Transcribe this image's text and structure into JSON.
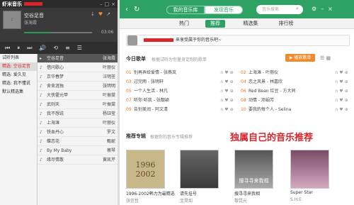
{
  "app": {
    "title": "虾米音乐"
  },
  "now_playing": {
    "song": "空谷足音",
    "artist": "张海霞",
    "time": "03:06",
    "progress": 0.4
  },
  "playlists": [
    {
      "label": "试听列表"
    },
    {
      "label": "精选: 空谷足音"
    },
    {
      "label": "精选: 爱久见"
    },
    {
      "label": "精选: 我不懂说"
    },
    {
      "label": "默认精选集"
    }
  ],
  "tracks": [
    {
      "num": "",
      "title": "空谷足音",
      "artist": "张海霞"
    },
    {
      "num": "",
      "title": "借问歌心",
      "artist": "叶丽仪"
    },
    {
      "num": "",
      "title": "京华春梦",
      "artist": "汪明荃"
    },
    {
      "num": "",
      "title": "舍舍涯独",
      "artist": "张明明"
    },
    {
      "num": "",
      "title": "大侠霍元甲",
      "artist": "叶振棠"
    },
    {
      "num": "",
      "title": "武则天",
      "artist": "叶振棠"
    },
    {
      "num": "",
      "title": "我不想说",
      "artist": "杨钰莹"
    },
    {
      "num": "",
      "title": "上海滩",
      "artist": "叶丽仪"
    },
    {
      "num": "",
      "title": "铁血丹心",
      "artist": "罗文"
    },
    {
      "num": "",
      "title": "蝶恋花",
      "artist": "甄妮"
    },
    {
      "num": "",
      "title": "By My Baby",
      "artist": "蔡琴"
    },
    {
      "num": "",
      "title": "缘尽情散",
      "artist": "黄凯芹"
    }
  ],
  "store": {
    "tabs": [
      "我的音乐库",
      "发现音乐"
    ],
    "search_placeholder": "音乐搜索",
    "subnav": [
      "热门",
      "推荐",
      "精选集",
      "排行榜"
    ],
    "greeting": "来享受属于你的音乐吧~",
    "daily_title": "今日歌单",
    "daily_sub": "根据试听为你量身定制的歌单",
    "add_button": "▶ 播放歌单",
    "daily_left": [
      {
        "n": "01",
        "t": "别再弄给爱情 - 张燕岚"
      },
      {
        "n": "03",
        "t": "过完雨 - 张明轩"
      },
      {
        "n": "05",
        "t": "一个人生活 - 林凡"
      },
      {
        "n": "07",
        "t": "听你·听我 - 张靓颖"
      },
      {
        "n": "09",
        "t": "告别美润 - 阿文清"
      }
    ],
    "daily_right": [
      {
        "n": "02",
        "t": "上海滩 - 叶丽仪"
      },
      {
        "n": "04",
        "t": "恋之风景 - 林嘉欣"
      },
      {
        "n": "06",
        "t": "Red Bean 红豆 - 方大同"
      },
      {
        "n": "08",
        "t": "动情 - 邓娟芳"
      },
      {
        "n": "10",
        "t": "要我的每个人 - Selina"
      }
    ],
    "rec_title": "推荐专辑",
    "rec_sub": "根据你的音乐专辑推荐",
    "slogan": "独属自己的音乐推荐",
    "albums": [
      {
        "title": "1996-2002韩力为最精选",
        "artist": "张信哲",
        "cover": "1996\n2002"
      },
      {
        "title": "请先挂号",
        "artist": "宝晃如",
        "cover": ""
      },
      {
        "title": "搜寻寻来我相",
        "artist": "黎昆元",
        "cover": "搜寻寻来我相"
      },
      {
        "title": "Super Star",
        "artist": "S.H.E",
        "cover": ""
      }
    ]
  }
}
